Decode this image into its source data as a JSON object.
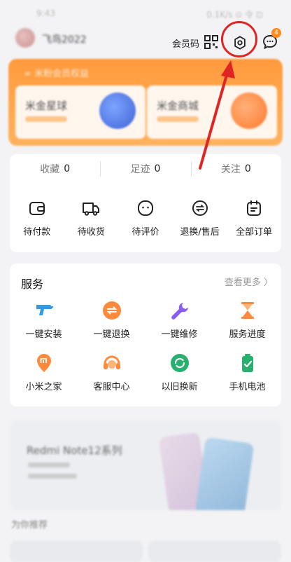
{
  "status_bar": {
    "time": "9:43",
    "right": "0.1K/s ⊙ 令 ⊡"
  },
  "header": {
    "username": "飞鸟2022",
    "member_code_label": "会员码",
    "badge_count": "4"
  },
  "banner": {
    "title": "∞ 米粉会员权益",
    "cards": [
      {
        "title": "米金星球",
        "color": "#4b7be8"
      },
      {
        "title": "米金商城",
        "color": "#ff8a3c"
      }
    ]
  },
  "stats": [
    {
      "label": "收藏",
      "value": "0"
    },
    {
      "label": "足迹",
      "value": "0"
    },
    {
      "label": "关注",
      "value": "0"
    }
  ],
  "orders": [
    {
      "label": "待付款",
      "icon": "wallet-icon"
    },
    {
      "label": "待收货",
      "icon": "truck-icon"
    },
    {
      "label": "待评价",
      "icon": "comment-icon"
    },
    {
      "label": "退换/售后",
      "icon": "exchange-icon"
    },
    {
      "label": "全部订单",
      "icon": "clipboard-icon"
    }
  ],
  "services": {
    "title": "服务",
    "more": "查看更多 〉",
    "items": [
      {
        "label": "一键安装",
        "icon": "drill-icon",
        "color": "#2f9ae8"
      },
      {
        "label": "一键退换",
        "icon": "swap-icon",
        "color": "#ff8a3c"
      },
      {
        "label": "一键维修",
        "icon": "wrench-icon",
        "color": "#8a5cf0"
      },
      {
        "label": "服务进度",
        "icon": "hourglass-icon",
        "color": "#ff8a3c"
      },
      {
        "label": "小米之家",
        "icon": "location-pin-icon",
        "color": "#ff8a3c"
      },
      {
        "label": "客服中心",
        "icon": "headset-icon",
        "color": "#ff8a3c"
      },
      {
        "label": "以旧换新",
        "icon": "recycle-icon",
        "color": "#27b06e"
      },
      {
        "label": "手机电池",
        "icon": "battery-icon",
        "color": "#27b06e"
      }
    ]
  },
  "promo": {
    "title": "Redmi Note12系列"
  },
  "recommend": {
    "title": "为你推荐"
  },
  "colors": {
    "accent": "#ff8a1f",
    "annotation": "#e02424"
  }
}
